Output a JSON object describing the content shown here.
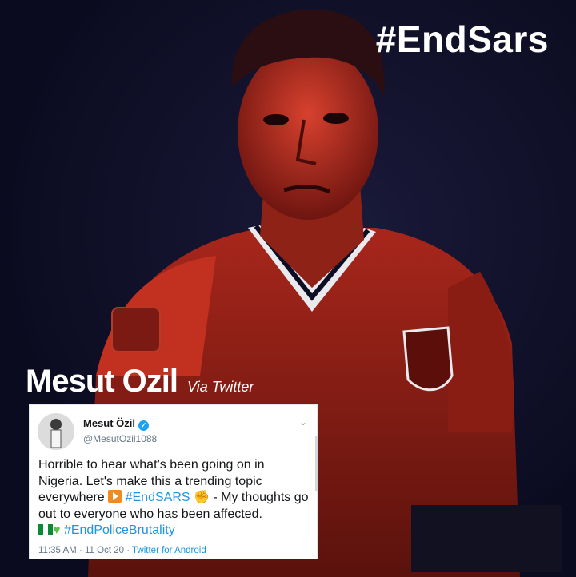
{
  "poster": {
    "hashtag": "#EndSars",
    "player_name": "Mesut Ozil",
    "via": "Via Twitter",
    "colors": {
      "background": "#0d0d24",
      "tint": "#c0271a",
      "accent": "#1da1f2"
    }
  },
  "tweet": {
    "author": "Mesut Özil",
    "handle": "@MesutOzil1088",
    "text_1": "Horrible to hear what’s been going on in Nigeria. Let's make this a trending topic everywhere",
    "hashtag_1": "#EndSARS",
    "text_2": " - My thoughts go out to everyone who has been affected.",
    "hashtag_2": "#EndPoliceBrutality",
    "time": "11:35 AM",
    "date": "11 Oct 20",
    "source": "Twitter for Android",
    "icons": [
      "verified-badge-icon",
      "chevron-down-icon",
      "play-button-emoji-icon",
      "fist-emoji-icon",
      "nigeria-flag-icon",
      "green-heart-icon"
    ]
  }
}
